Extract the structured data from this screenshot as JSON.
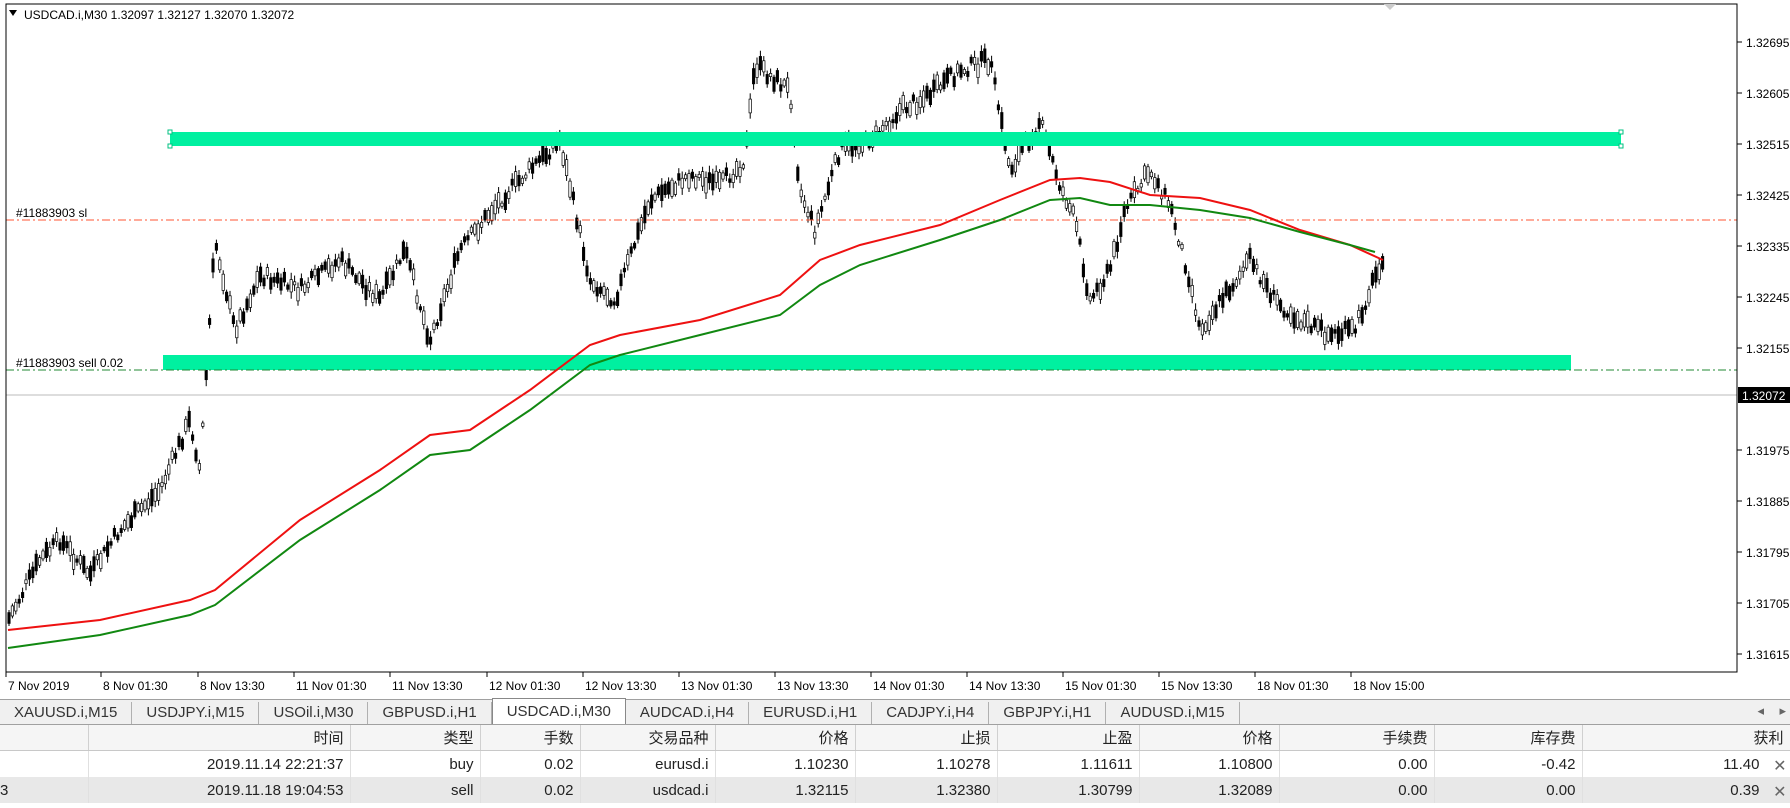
{
  "chart": {
    "header": "USDCAD.i,M30  1.32097 1.32127 1.32070 1.32072",
    "sl_label": "#11883903 sl",
    "sell_label": "#11883903 sell 0.02",
    "current_price": "1.32072",
    "price_labels": [
      "1.32695",
      "1.32605",
      "1.32515",
      "1.32425",
      "1.32335",
      "1.32245",
      "1.32155",
      "1.31975",
      "1.31885",
      "1.31795",
      "1.31705",
      "1.31615"
    ],
    "time_labels": [
      "7 Nov 2019",
      "8 Nov 01:30",
      "8 Nov 13:30",
      "11 Nov 01:30",
      "11 Nov 13:30",
      "12 Nov 01:30",
      "12 Nov 13:30",
      "13 Nov 01:30",
      "13 Nov 13:30",
      "14 Nov 01:30",
      "14 Nov 13:30",
      "15 Nov 01:30",
      "15 Nov 13:30",
      "18 Nov 01:30",
      "18 Nov 15:00"
    ],
    "colors": {
      "zone": "#00f0a0",
      "ma_red": "#ee1111",
      "ma_green": "#118811",
      "sl_line": "#ff5533",
      "entry_line": "#228833",
      "candle": "#000000"
    }
  },
  "tabs": [
    {
      "label": "XAUUSD.i,M15"
    },
    {
      "label": "USDJPY.i,M15"
    },
    {
      "label": "USOil.i,M30"
    },
    {
      "label": "GBPUSD.i,H1"
    },
    {
      "label": "USDCAD.i,M30"
    },
    {
      "label": "AUDCAD.i,H4"
    },
    {
      "label": "EURUSD.i,H1"
    },
    {
      "label": "CADJPY.i,H4"
    },
    {
      "label": "GBPJPY.i,H1"
    },
    {
      "label": "AUDUSD.i,M15"
    }
  ],
  "active_tab": 4,
  "orders": {
    "columns": [
      "",
      "时间",
      "类型",
      "手数",
      "交易品种",
      "价格",
      "止损",
      "止盈",
      "价格",
      "手续费",
      "库存费",
      "获利"
    ],
    "rows": [
      {
        "ticket": "",
        "time": "2019.11.14 22:21:37",
        "type": "buy",
        "lots": "0.02",
        "symbol": "eurusd.i",
        "price": "1.10230",
        "sl": "1.10278",
        "tp": "1.11611",
        "cur": "1.10800",
        "commission": "0.00",
        "swap": "-0.42",
        "profit": "11.40"
      },
      {
        "ticket": "3",
        "time": "2019.11.18 19:04:53",
        "type": "sell",
        "lots": "0.02",
        "symbol": "usdcad.i",
        "price": "1.32115",
        "sl": "1.32380",
        "tp": "1.30799",
        "cur": "1.32089",
        "commission": "0.00",
        "swap": "0.00",
        "profit": "0.39"
      }
    ]
  }
}
